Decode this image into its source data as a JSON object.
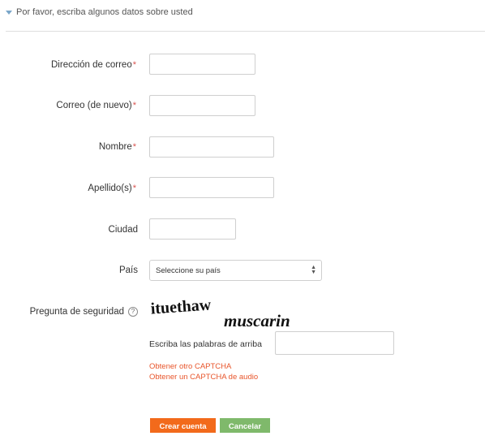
{
  "section": {
    "title": "Por favor, escriba algunos datos sobre usted"
  },
  "fields": {
    "email": {
      "label": "Dirección de correo",
      "required": "*"
    },
    "email2": {
      "label": "Correo (de nuevo)",
      "required": "*"
    },
    "firstname": {
      "label": "Nombre",
      "required": "*"
    },
    "lastname": {
      "label": "Apellido(s)",
      "required": "*"
    },
    "city": {
      "label": "Ciudad"
    },
    "country": {
      "label": "País",
      "selected": "Seleccione su país"
    }
  },
  "captcha": {
    "label": "Pregunta de seguridad",
    "help_icon": "?",
    "word1": "ituethaw",
    "word2": "muscarin",
    "input_label": "Escriba las palabras de arriba",
    "link_other": "Obtener otro CAPTCHA",
    "link_audio": "Obtener un CAPTCHA de audio"
  },
  "buttons": {
    "create": "Crear cuenta",
    "cancel": "Cancelar"
  },
  "colors": {
    "create": "#f26a1b",
    "cancel": "#7fb96b",
    "link": "#e8552b"
  }
}
